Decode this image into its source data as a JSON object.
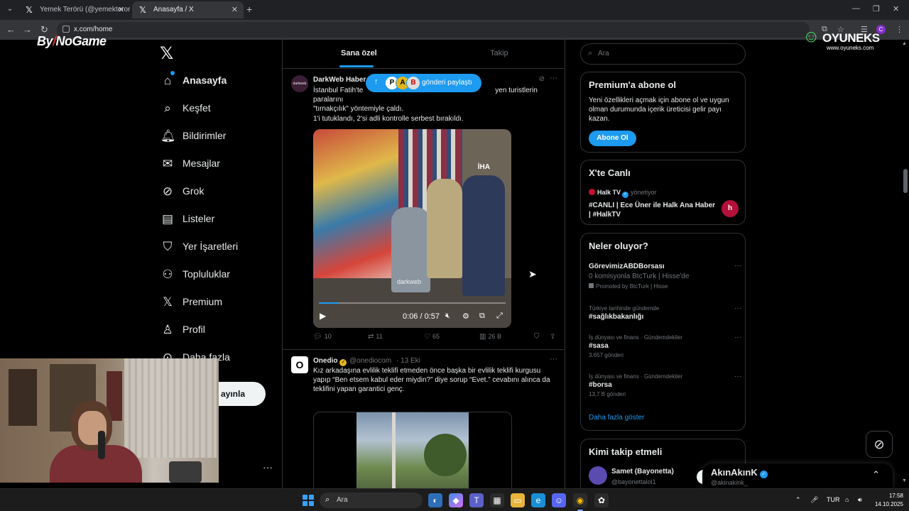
{
  "browser": {
    "tabs": [
      {
        "title": "Yemek Terörü (@yemekteroru_",
        "icon": "x-logo-icon"
      },
      {
        "title": "Anasayfa / X",
        "icon": "x-logo-icon"
      }
    ],
    "url": "x.com/home"
  },
  "overlays": {
    "bynogame": {
      "pre": "By",
      "slash": "/",
      "name": "NoGame"
    },
    "oyuneks": {
      "name": "OYUNEKS",
      "url": "www.oyuneks.com"
    }
  },
  "sidebar": {
    "items": [
      {
        "label": "Anasayfa",
        "icon": "home-icon"
      },
      {
        "label": "Keşfet",
        "icon": "search-icon"
      },
      {
        "label": "Bildirimler",
        "icon": "bell-icon"
      },
      {
        "label": "Mesajlar",
        "icon": "mail-icon"
      },
      {
        "label": "Grok",
        "icon": "grok-icon"
      },
      {
        "label": "Listeler",
        "icon": "list-icon"
      },
      {
        "label": "Yer İşaretleri",
        "icon": "bookmark-icon"
      },
      {
        "label": "Topluluklar",
        "icon": "communities-icon"
      },
      {
        "label": "Premium",
        "icon": "x-logo-icon"
      },
      {
        "label": "Profil",
        "icon": "person-icon"
      },
      {
        "label": "Daha fazla",
        "icon": "more-circle-icon"
      }
    ],
    "post_button": "ayınla",
    "more": "···"
  },
  "feed": {
    "tabs": [
      "Sana özel",
      "Takip"
    ],
    "share_pill": {
      "label": "gönderi paylaştı"
    },
    "tweets": [
      {
        "name": "DarkWeb Haber",
        "avatar_text": "darkweb",
        "text_line1": "İstanbul Fatih'te",
        "text_line1_end": "yen turistlerin paralarını",
        "text_line2": "\"tırnakçılık\" yöntemiyle çaldı.",
        "text_line3": "1'i tutuklandı, 2'si adli kontrolle serbest bırakıldı.",
        "video": {
          "time": "0:06 / 0:57",
          "progress": 0.105,
          "watermark": "darkweb",
          "agency": "İHA"
        },
        "stats": {
          "replies": "10",
          "reposts": "11",
          "likes": "65",
          "views": "26 B"
        }
      },
      {
        "name": "Onedio",
        "handle": "@onediocom",
        "date": "· 13 Eki",
        "avatar_text": "O",
        "text": "Kız arkadaşına evlilik teklifi etmeden önce başka bir evlilik teklifi kurgusu yapıp “Ben etsem kabul eder miydin?” diye sorup “Evet.” cevabını alınca da teklifini yapan garantici genç."
      }
    ]
  },
  "right": {
    "search_placeholder": "Ara",
    "premium": {
      "title": "Premium'a abone ol",
      "text": "Yeni özellikleri açmak için abone ol ve uygun olman durumunda içerik üreticisi gelir payı kazan.",
      "button": "Abone Ol"
    },
    "live": {
      "title": "X'te Canlı",
      "source": "Halk TV",
      "role": "yönetiyor",
      "headline": "#CANLI | Ece Üner ile Halk Ana Haber | #HalkTV",
      "badge": "h"
    },
    "trends": {
      "title": "Neler oluyor?",
      "items": [
        {
          "name": "GörevimizABDBorsası",
          "sub": "0 komisyonla BtcTurk | Hisse'de",
          "promo": "Promoted by BtcTurk | Hisse"
        },
        {
          "meta": "Türkiye tarihinde gündemde",
          "name": "#sağlıkbakanlığı"
        },
        {
          "meta": "İş dünyası ve finans · Gündemdekiler",
          "name": "#sasa",
          "count": "3.657 gönderi"
        },
        {
          "meta": "İş dünyası ve finans · Gündemdekiler",
          "name": "#borsa",
          "count": "13,7 B gönderi"
        }
      ],
      "show_more": "Daha fazla göster"
    },
    "who_to_follow": {
      "title": "Kimi takip etmeli",
      "name": "Samet (Bayonetta)",
      "handle": "@bayonettalol1"
    }
  },
  "messages_drawer": {
    "name": "AkınAkınK",
    "handle": "@akinakink_"
  },
  "taskbar": {
    "search_placeholder": "Ara",
    "lang": "TUR",
    "time": "17:58",
    "date": "14.10.2025"
  },
  "colors": {
    "accent": "#1d9bf0",
    "background": "#000000",
    "text": "#e7e9ea",
    "muted": "#71767b",
    "border": "#2f3336"
  }
}
